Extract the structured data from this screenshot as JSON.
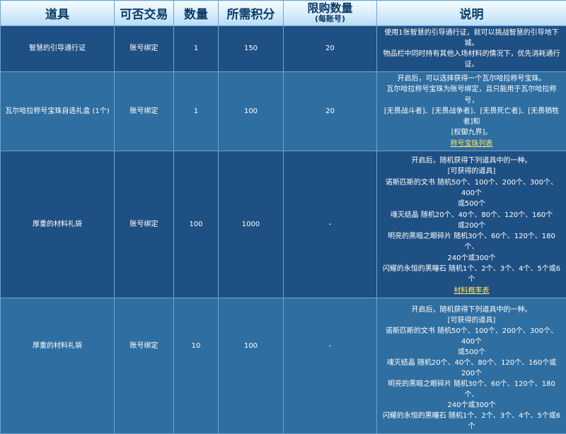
{
  "headers": {
    "item": "道具",
    "tradable": "可否交易",
    "quantity": "数量",
    "points": "所需积分",
    "limit": "限购数量",
    "limit_sub": "(每账号)",
    "desc": "说明"
  },
  "rows": [
    {
      "item": "智慧的引导通行证",
      "tradable": "账号绑定",
      "quantity": "1",
      "points": "150",
      "limit": "20",
      "desc_lines": [
        "使用1张智慧的引导通行证，就可以挑战智慧的引导地下城。",
        "物品栏中同时持有其他入场材料的情况下，优先消耗通行证。"
      ]
    },
    {
      "item": "瓦尔哈拉称号宝珠自选礼盒 (1个)",
      "tradable": "账号绑定",
      "quantity": "1",
      "points": "100",
      "limit": "20",
      "desc_lines": [
        "开启后，可以选择获得一个瓦尔哈拉称号宝珠。",
        "瓦尔哈拉称号宝珠为账号绑定，且只能用于瓦尔哈拉称号，",
        "[无畏战斗者]、[无畏战争者]、[无畏死亡者]、[无畏牺牲者]和",
        "[权御九界]。"
      ],
      "link": "称号宝珠列表"
    },
    {
      "item": "厚重的材料礼袋",
      "tradable": "账号绑定",
      "quantity": "100",
      "points": "1000",
      "limit": "-",
      "desc_lines": [
        "开启后，随机获得下列道具中的一种。",
        "[可获得的道具]",
        "诺斯匹斯的文书 随机50个、100个、200个、300个、400个",
        "或500个",
        "魂灭结晶 随机20个、40个、80个、120个、160个",
        "或200个",
        "明亮的黑暗之眼碎片 随机30个、60个、120个、180个、",
        "240个或300个",
        "闪耀的永恒的黑瞳石 随机1个、2个、3个、4个、5个或6个"
      ],
      "link": "材料概率表"
    },
    {
      "item": "厚重的材料礼袋",
      "tradable": "账号绑定",
      "quantity": "10",
      "points": "100",
      "limit": "-",
      "desc_lines": [
        "开启后，随机获得下列道具中的一种。",
        "[可获得的道具]",
        "诺斯匹斯的文书 随机50个、100个、200个、300个、400个",
        "或500个",
        "魂灭结晶 随机20个、40个、80个、120个、160个或200个",
        "明亮的黑暗之眼碎片 随机30个、60个、120个、180个、",
        "240个或300个",
        "闪耀的永恒的黑瞳石 随机1个、2个、3个、4个、5个或6个"
      ]
    }
  ]
}
